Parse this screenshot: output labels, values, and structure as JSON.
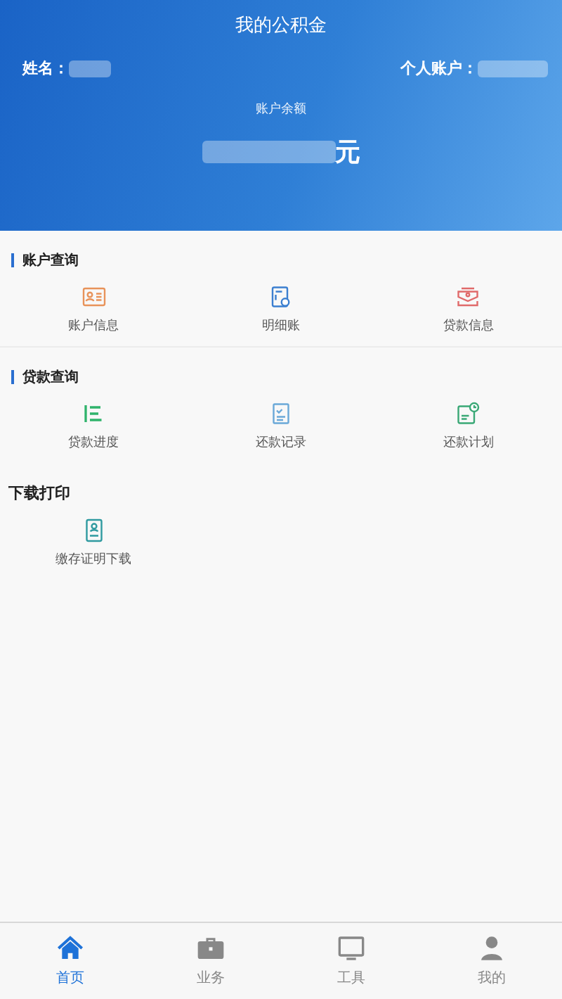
{
  "header": {
    "title": "我的公积金",
    "name_label": "姓名：",
    "account_label": "个人账户：",
    "balance_label": "账户余额",
    "balance_unit": "元"
  },
  "sections": [
    {
      "title": "账户查询",
      "marker": true,
      "items": [
        {
          "label": "账户信息",
          "kind": "card"
        },
        {
          "label": "明细账",
          "kind": "ledger"
        },
        {
          "label": "贷款信息",
          "kind": "loan"
        }
      ]
    },
    {
      "title": "贷款查询",
      "marker": true,
      "items": [
        {
          "label": "贷款进度",
          "kind": "progress"
        },
        {
          "label": "还款记录",
          "kind": "record"
        },
        {
          "label": "还款计划",
          "kind": "plan"
        }
      ]
    },
    {
      "title": "下载打印",
      "marker": false,
      "items": [
        {
          "label": "缴存证明下载",
          "kind": "certificate"
        }
      ]
    }
  ],
  "tabs": [
    {
      "label": "首页",
      "kind": "home",
      "selected": true
    },
    {
      "label": "业务",
      "kind": "business",
      "selected": false
    },
    {
      "label": "工具",
      "kind": "tools",
      "selected": false
    },
    {
      "label": "我的",
      "kind": "me",
      "selected": false
    }
  ]
}
